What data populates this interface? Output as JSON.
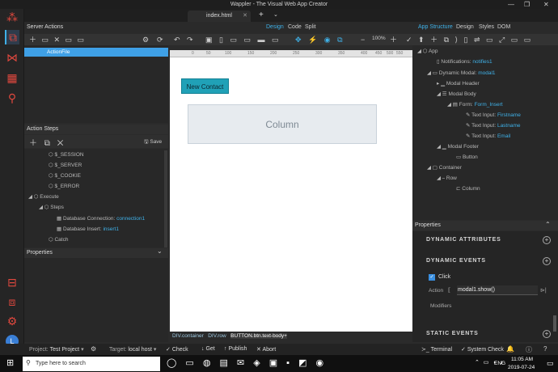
{
  "window": {
    "title": "Wappler - The Visual Web App Creator"
  },
  "tabs": [
    {
      "label": "index.html"
    }
  ],
  "header": {
    "server_actions": "Server Actions",
    "modes": {
      "design": "Design",
      "code": "Code",
      "split": "Split"
    },
    "right_modes": {
      "app_structure": "App Structure",
      "design": "Design",
      "styles": "Styles",
      "dom": "DOM"
    },
    "zoom": "100%"
  },
  "server_actions": {
    "selected": "ActionFile"
  },
  "action_steps": {
    "title": "Action Steps",
    "save": "Save",
    "items": [
      {
        "label": "$_SESSION"
      },
      {
        "label": "$_SERVER"
      },
      {
        "label": "$_COOKIE"
      },
      {
        "label": "$_ERROR"
      }
    ],
    "execute": "Execute",
    "steps": "Steps",
    "db_conn_label": "Database Connection:",
    "db_conn_value": "connection1",
    "db_insert_label": "Database Insert:",
    "db_insert_value": "insert1",
    "catch": "Catch"
  },
  "properties_left": {
    "title": "Properties"
  },
  "ruler": {
    "ticks": [
      "0",
      "50",
      "100",
      "150",
      "200",
      "250",
      "300",
      "350",
      "400",
      "450",
      "500",
      "550"
    ]
  },
  "canvas": {
    "button_label": "New Contact",
    "column_label": "Column"
  },
  "breadcrumb": {
    "items": [
      "DIV.container",
      "DIV.row",
      "BUTTON.btn.text-body+"
    ]
  },
  "app_structure": {
    "app": "App",
    "notifications_label": "Notifications:",
    "notifications_value": "notifies1",
    "modal_label": "Dynamic Modal:",
    "modal_value": "modal1",
    "modal_header": "Modal Header",
    "modal_body": "Modal Body",
    "form_label": "Form:",
    "form_value": "Form_Insert",
    "inputs": [
      {
        "label": "Text Input:",
        "value": "Firstname"
      },
      {
        "label": "Text Input:",
        "value": "Lastname"
      },
      {
        "label": "Text Input:",
        "value": "Email"
      }
    ],
    "modal_footer": "Modal Footer",
    "button": "Button",
    "container": "Container",
    "row": "Row",
    "column": "Column"
  },
  "properties_right": {
    "title": "Properties",
    "dynamic_attributes": "DYNAMIC ATTRIBUTES",
    "dynamic_events": "DYNAMIC EVENTS",
    "click": "Click",
    "action_label": "Action",
    "action_value": "modal1.show()",
    "modifiers": "Modifiers",
    "static_events": "STATIC EVENTS"
  },
  "status": {
    "project_label": "Project:",
    "project_value": "Test Project",
    "target_label": "Target:",
    "target_value": "local host",
    "check": "Check",
    "get": "Get",
    "publish": "Publish",
    "abort": "Abort",
    "terminal": "Terminal",
    "system_check": "System Check"
  },
  "taskbar": {
    "search_placeholder": "Type here to search",
    "time": "11:05 AM",
    "date": "2019-07-24",
    "lang": "ENG"
  },
  "user": {
    "initial": "L"
  }
}
